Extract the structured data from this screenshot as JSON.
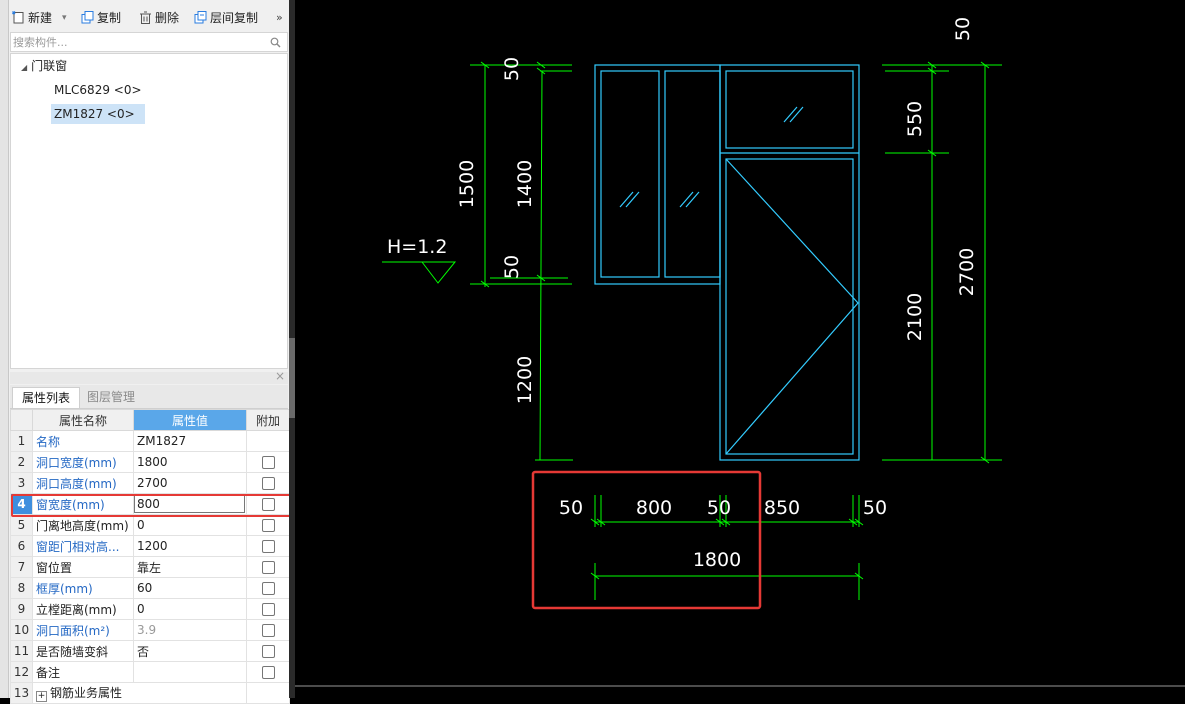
{
  "toolbar": {
    "new_label": "新建",
    "copy_label": "复制",
    "delete_label": "删除",
    "floor_copy_label": "层间复制",
    "more_label": "»"
  },
  "search": {
    "placeholder": "搜索构件..."
  },
  "tree": {
    "group_label": "门联窗",
    "items": [
      {
        "label": "MLC6829 <0>"
      },
      {
        "label": "ZM1827 <0>",
        "selected": true
      }
    ]
  },
  "panel": {
    "close_glyph": "×",
    "tabs": [
      {
        "label": "属性列表",
        "active": true
      },
      {
        "label": "图层管理"
      }
    ],
    "headers": {
      "name": "属性名称",
      "value": "属性值",
      "extra": "附加"
    },
    "rows": [
      {
        "index": "1",
        "name": "名称",
        "value": "ZM1827",
        "blue": true,
        "checkbox": false
      },
      {
        "index": "2",
        "name": "洞口宽度(mm)",
        "value": "1800",
        "blue": true,
        "checkbox": true
      },
      {
        "index": "3",
        "name": "洞口高度(mm)",
        "value": "2700",
        "blue": true,
        "checkbox": true
      },
      {
        "index": "4",
        "name": "窗宽度(mm)",
        "value": "800",
        "blue": true,
        "checkbox": true,
        "editing": true
      },
      {
        "index": "5",
        "name": "门离地高度(mm)",
        "value": "0",
        "blue": false,
        "checkbox": true
      },
      {
        "index": "6",
        "name": "窗距门相对高...",
        "value": "1200",
        "blue": true,
        "checkbox": true
      },
      {
        "index": "7",
        "name": "窗位置",
        "value": "靠左",
        "blue": false,
        "checkbox": true
      },
      {
        "index": "8",
        "name": "框厚(mm)",
        "value": "60",
        "blue": true,
        "checkbox": true
      },
      {
        "index": "9",
        "name": "立樘距离(mm)",
        "value": "0",
        "blue": false,
        "checkbox": true
      },
      {
        "index": "10",
        "name": "洞口面积(m²)",
        "value": "3.9",
        "blue": true,
        "grey_value": true,
        "checkbox": true
      },
      {
        "index": "11",
        "name": "是否随墙变斜",
        "value": "否",
        "blue": false,
        "checkbox": true
      },
      {
        "index": "12",
        "name": "备注",
        "value": "",
        "blue": false,
        "checkbox": true
      },
      {
        "index": "13",
        "name": "钢筋业务属性",
        "value": "",
        "blue": false,
        "checkbox": false,
        "expandable": true
      }
    ]
  },
  "drawing": {
    "colors": {
      "background": "#000000",
      "dimension": "#00ff00",
      "outline": "#33ccff",
      "text": "#ffffff",
      "highlight": "#e53935"
    },
    "elevation_label": "H=1.2",
    "dim_left_outer": "1500",
    "dim_left_top": "50",
    "dim_left_window": "1400",
    "dim_left_mid": "50",
    "dim_left_bottom": "1200",
    "dim_right_top": "50",
    "dim_right_transom": "550",
    "dim_right_door": "2100",
    "dim_right_total": "2700",
    "dim_bottom_frame_left": "50",
    "dim_bottom_window": "800",
    "dim_bottom_frame_mid": "50",
    "dim_bottom_door": "850",
    "dim_bottom_frame_right": "50",
    "dim_bottom_total": "1800"
  }
}
